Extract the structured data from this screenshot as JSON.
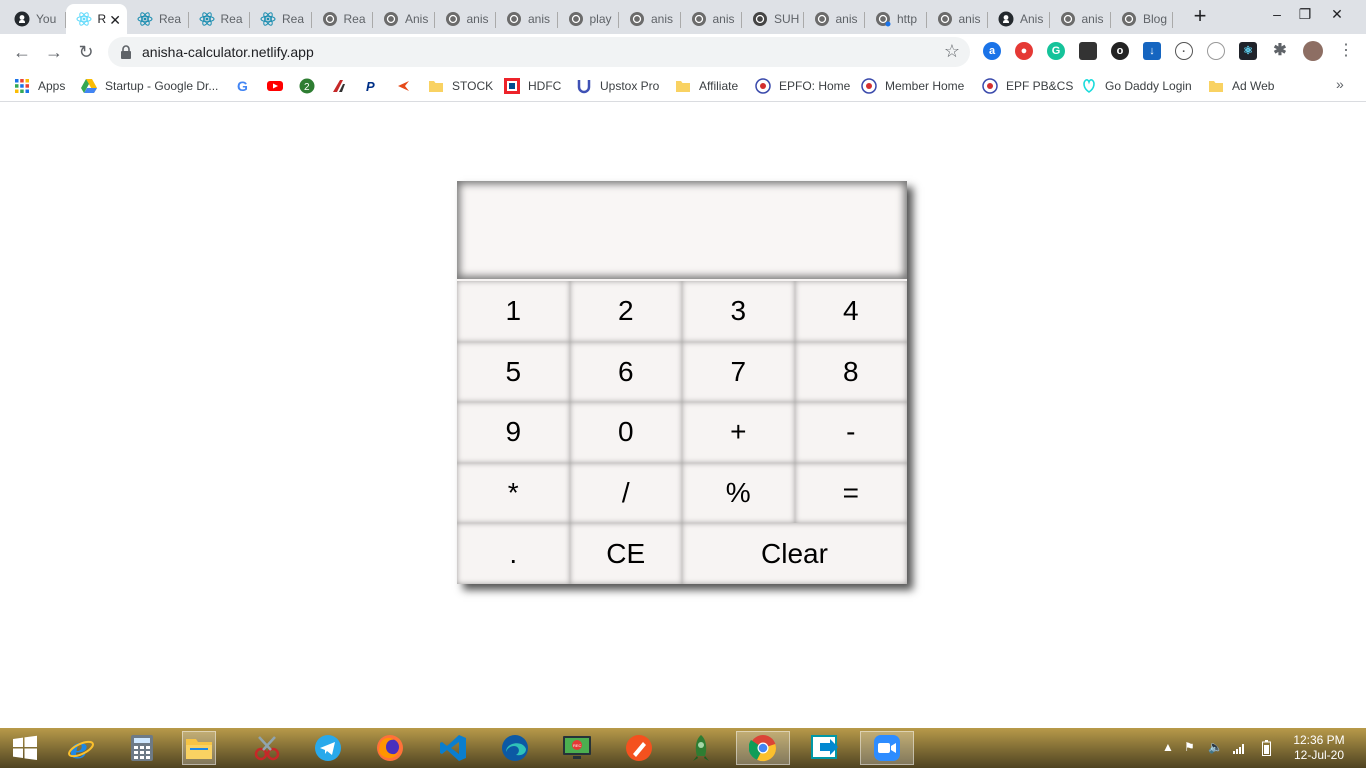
{
  "browser": {
    "tabs": [
      {
        "title": "You",
        "icon": "github-icon"
      },
      {
        "title": "R",
        "icon": "react-icon",
        "active": true
      },
      {
        "title": "Rea",
        "icon": "react-icon"
      },
      {
        "title": "Rea",
        "icon": "react-icon"
      },
      {
        "title": "Rea",
        "icon": "react-icon"
      },
      {
        "title": "Rea",
        "icon": "globe-icon"
      },
      {
        "title": "Anis",
        "icon": "globe-icon"
      },
      {
        "title": "anis",
        "icon": "globe-icon"
      },
      {
        "title": "anis",
        "icon": "globe-icon"
      },
      {
        "title": "play",
        "icon": "globe-icon"
      },
      {
        "title": "anis",
        "icon": "globe-icon"
      },
      {
        "title": "anis",
        "icon": "globe-icon"
      },
      {
        "title": "SUH",
        "icon": "globe-icon"
      },
      {
        "title": "anis",
        "icon": "globe-icon"
      },
      {
        "title": "http",
        "icon": "globe-icon"
      },
      {
        "title": "anis",
        "icon": "globe-icon"
      },
      {
        "title": "Anis",
        "icon": "github-icon"
      },
      {
        "title": "anis",
        "icon": "globe-icon"
      },
      {
        "title": "Blog",
        "icon": "globe-icon"
      }
    ],
    "url": "anisha-calculator.netlify.app",
    "bookmarks": {
      "apps": "Apps",
      "startup": "Startup - Google Dr...",
      "stock": "STOCK",
      "hdfc": "HDFC",
      "upstox": "Upstox Pro",
      "affiliate": "Affiliate",
      "epfo": "EPFO: Home",
      "member": "Member Home",
      "epf": "EPF PB&CS",
      "godaddy": "Go Daddy Login",
      "adweb": "Ad Web"
    }
  },
  "calculator": {
    "display": "",
    "keys": [
      "1",
      "2",
      "3",
      "4",
      "5",
      "6",
      "7",
      "8",
      "9",
      "0",
      "+",
      "-",
      "*",
      "/",
      "%",
      "=",
      ".",
      "CE",
      "Clear"
    ]
  },
  "taskbar": {
    "time": "12:36 PM",
    "date": "12-Jul-20"
  },
  "colors": {
    "tabstrip": "#dee1e6",
    "calc_bg": "#f7f4f3",
    "react": "#61dafb"
  }
}
